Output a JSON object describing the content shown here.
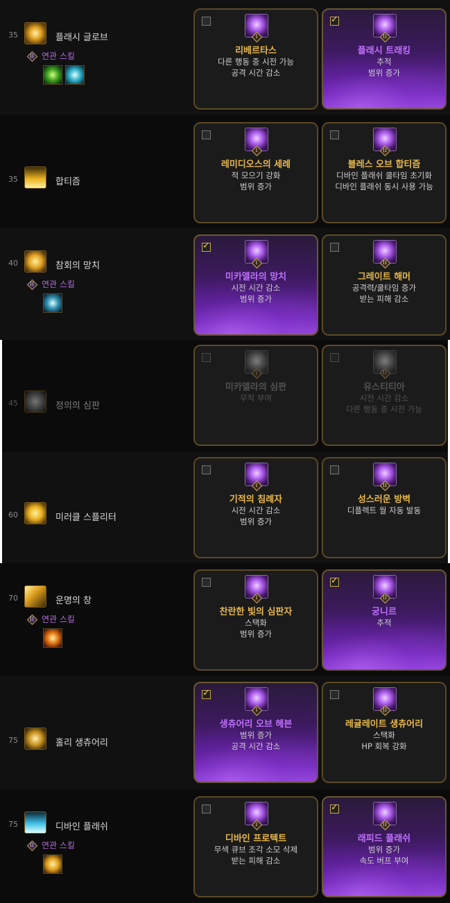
{
  "related_label": "연관 스킬",
  "rows": [
    {
      "level": "35",
      "skill": "플래시 글로브",
      "icon": "flash-globe-icon",
      "related": true,
      "related_icons": [
        "green-burst-icon",
        "cyan-swirl-icon"
      ],
      "cards": [
        {
          "checked": false,
          "selected": false,
          "tier": "I",
          "title": "리베르타스",
          "lines": [
            "다른 행동 중 시전 가능",
            "공격 시간 감소"
          ]
        },
        {
          "checked": true,
          "selected": true,
          "tier": "II",
          "title": "플래시 트래킹",
          "lines": [
            "추적",
            "범위 증가"
          ]
        }
      ]
    },
    {
      "level": "35",
      "skill": "합티즘",
      "icon": "baptism-light-icon",
      "related": false,
      "cards": [
        {
          "checked": false,
          "selected": false,
          "tier": "I",
          "title": "레미디오스의 세례",
          "lines": [
            "적 모으기 강화",
            "범위 증가"
          ]
        },
        {
          "checked": false,
          "selected": false,
          "tier": "II",
          "title": "블레스 오브 합티즘",
          "lines": [
            "디바인 플래쉬 쿨타임 초기화",
            "디바인 플래쉬 동시 사용 가능"
          ]
        }
      ]
    },
    {
      "level": "40",
      "skill": "참회의 망치",
      "icon": "hammer-icon",
      "related": true,
      "related_icons": [
        "cyan-emblem-icon"
      ],
      "cards": [
        {
          "checked": true,
          "selected": true,
          "tier": "I",
          "title": "미카엘라의 망치",
          "lines": [
            "시전 시간 감소",
            "범위 증가"
          ]
        },
        {
          "checked": false,
          "selected": false,
          "tier": "II",
          "title": "그레이트 해머",
          "lines": [
            "공격력/쿨타임 증가",
            "받는 피해 감소"
          ]
        }
      ]
    },
    {
      "level": "45",
      "skill": "정의의 심판",
      "icon": "judgement-icon",
      "related": false,
      "dim": true,
      "cards": [
        {
          "checked": false,
          "selected": false,
          "dim": true,
          "tier": "I",
          "title": "미카엘라의 심판",
          "lines": [
            "무적 부여"
          ]
        },
        {
          "checked": false,
          "selected": false,
          "dim": true,
          "tier": "II",
          "title": "유스티티아",
          "lines": [
            "시전 시간 감소",
            "다른 행동 중 시전 가능"
          ]
        }
      ]
    },
    {
      "level": "60",
      "skill": "미러클 스플리터",
      "icon": "miracle-splitter-icon",
      "related": false,
      "cards": [
        {
          "checked": false,
          "selected": false,
          "tier": "I",
          "title": "기적의 침례자",
          "lines": [
            "시전 시간 감소",
            "범위 증가"
          ]
        },
        {
          "checked": false,
          "selected": false,
          "tier": "II",
          "title": "성스러운 방벽",
          "lines": [
            "디플렉트 월 자동 발동"
          ]
        }
      ]
    },
    {
      "level": "70",
      "skill": "운명의 창",
      "icon": "spear-icon",
      "related": true,
      "related_icons": [
        "fire-burst-icon"
      ],
      "cards": [
        {
          "checked": false,
          "selected": false,
          "tier": "I",
          "title": "찬란한 빛의 심판자",
          "lines": [
            "스택화",
            "범위 증가"
          ]
        },
        {
          "checked": true,
          "selected": true,
          "tier": "II",
          "title": "궁니르",
          "lines": [
            "추적"
          ]
        }
      ]
    },
    {
      "level": "75",
      "skill": "홀리 생츄어리",
      "icon": "sanctuary-icon",
      "related": false,
      "cards": [
        {
          "checked": true,
          "selected": true,
          "tier": "I",
          "title": "생츄어리 오브 헤븐",
          "lines": [
            "범위 증가",
            "공격 시간 감소"
          ]
        },
        {
          "checked": false,
          "selected": false,
          "tier": "II",
          "title": "레귤레이트 생츄어리",
          "lines": [
            "스택화",
            "HP 회복 강화"
          ]
        }
      ]
    },
    {
      "level": "75",
      "skill": "디바인 플래쉬",
      "icon": "divine-flash-icon",
      "related": true,
      "related_icons": [
        "golden-wing-icon"
      ],
      "cards": [
        {
          "checked": false,
          "selected": false,
          "tier": "I",
          "title": "디바인 프로텍트",
          "lines": [
            "무색 큐브 조각 소모 삭제",
            "받는 피해 감소"
          ]
        },
        {
          "checked": true,
          "selected": true,
          "tier": "II",
          "title": "래피드 플래쉬",
          "lines": [
            "범위 증가",
            "속도 버프 부여"
          ]
        }
      ]
    }
  ]
}
